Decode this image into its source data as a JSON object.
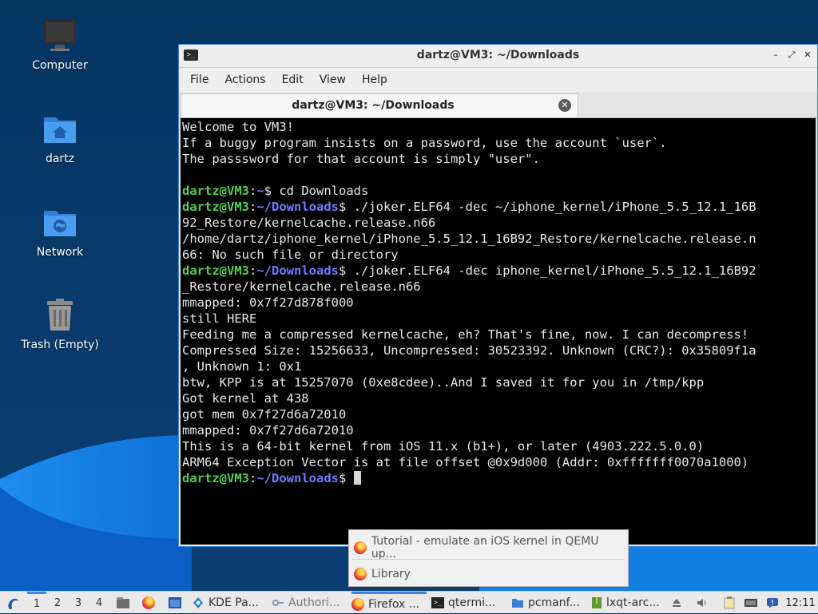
{
  "desktop": {
    "icons": [
      {
        "label": "Computer"
      },
      {
        "label": "dartz"
      },
      {
        "label": "Network"
      },
      {
        "label": "Trash (Empty)"
      }
    ]
  },
  "window": {
    "title": "dartz@VM3: ~/Downloads",
    "controls": {
      "minimize": "–",
      "maximize": "⤢",
      "close": "✕"
    },
    "menu": [
      "File",
      "Actions",
      "Edit",
      "View",
      "Help"
    ],
    "tab": {
      "label": "dartz@VM3: ~/Downloads",
      "close": "✕"
    }
  },
  "terminal": {
    "prompt_user": "dartz@VM3",
    "lines": [
      {
        "text": "Welcome to VM3!"
      },
      {
        "text": "If a buggy program insists on a password, use the account `user`."
      },
      {
        "text": "The passsword for that account is simply \"user\"."
      },
      {
        "text": ""
      },
      {
        "user": "dartz@VM3",
        "path": "~",
        "cmd": "$ cd Downloads"
      },
      {
        "user": "dartz@VM3",
        "path": "~/Downloads",
        "cmd": "$ ./joker.ELF64 -dec ~/iphone_kernel/iPhone_5.5_12.1_16B"
      },
      {
        "text": "92_Restore/kernelcache.release.n66"
      },
      {
        "text": "/home/dartz/iphone_kernel/iPhone_5.5_12.1_16B92_Restore/kernelcache.release.n"
      },
      {
        "text": "66: No such file or directory"
      },
      {
        "user": "dartz@VM3",
        "path": "~/Downloads",
        "cmd": "$ ./joker.ELF64 -dec iphone_kernel/iPhone_5.5_12.1_16B92"
      },
      {
        "text": "_Restore/kernelcache.release.n66"
      },
      {
        "text": "mmapped: 0x7f27d878f000"
      },
      {
        "text": "still HERE"
      },
      {
        "text": "Feeding me a compressed kernelcache, eh? That's fine, now. I can decompress!"
      },
      {
        "text": "Compressed Size: 15256633, Uncompressed: 30523392. Unknown (CRC?): 0x35809f1a"
      },
      {
        "text": ", Unknown 1: 0x1"
      },
      {
        "text": "btw, KPP is at 15257070 (0xe8cdee)..And I saved it for you in /tmp/kpp"
      },
      {
        "text": "Got kernel at 438"
      },
      {
        "text": "got mem 0x7f27d6a72010"
      },
      {
        "text": "mmapped: 0x7f27d6a72010"
      },
      {
        "text": "This is a 64-bit kernel from iOS 11.x (b1+), or later (4903.222.5.0.0)"
      },
      {
        "text": "ARM64 Exception Vector is at file offset @0x9d000 (Addr: 0xfffffff0070a1000)"
      },
      {
        "user": "dartz@VM3",
        "path": "~/Downloads",
        "cmd": "$ ",
        "cursor": true
      }
    ]
  },
  "popup": {
    "items": [
      "Tutorial - emulate an iOS kernel in QEMU up...",
      "Library"
    ]
  },
  "taskbar": {
    "desktops": [
      "1",
      "2",
      "3",
      "4"
    ],
    "tasks": [
      {
        "label": "KDE Pa..."
      },
      {
        "label": "Authori..."
      },
      {
        "label": "Firefox ..."
      },
      {
        "label": "qtermi..."
      },
      {
        "label": "pcmanf..."
      },
      {
        "label": "lxqt-arc..."
      }
    ],
    "clock": "12:11"
  },
  "colors": {
    "prompt_user": "#4fd14f",
    "prompt_path": "#6f7cff",
    "accent": "#3d86d9"
  }
}
